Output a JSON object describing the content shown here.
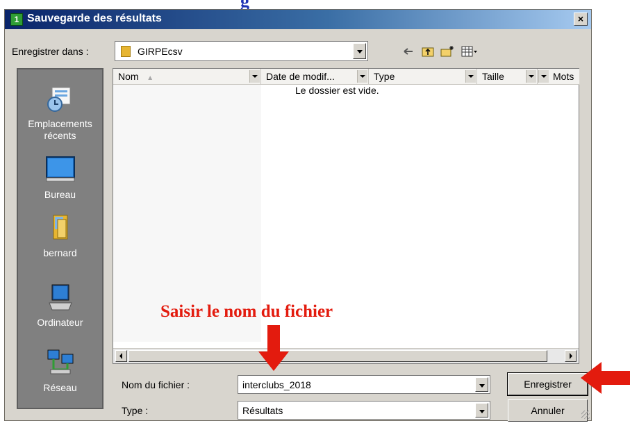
{
  "top_fragment": "g",
  "window": {
    "title": "Sauvegarde des résultats",
    "app_icon_text": "1",
    "close_label": "×"
  },
  "toolbar": {
    "lookin_label": "Enregistrer dans :",
    "lookin_value": "GIRPEcsv",
    "back_icon": "back-arrow-icon",
    "up_icon": "up-folder-icon",
    "newfolder_icon": "new-folder-icon",
    "views_icon": "views-menu-icon"
  },
  "places": [
    {
      "label": "Emplacements récents",
      "icon": "recent-places-icon"
    },
    {
      "label": "Bureau",
      "icon": "desktop-icon"
    },
    {
      "label": "bernard",
      "icon": "user-folder-icon"
    },
    {
      "label": "Ordinateur",
      "icon": "computer-icon"
    },
    {
      "label": "Réseau",
      "icon": "network-icon"
    }
  ],
  "file_list": {
    "columns": [
      "Nom",
      "Date de modif...",
      "Type",
      "Taille",
      "Mots"
    ],
    "sort_indicator": "▲",
    "empty_message": "Le dossier est vide."
  },
  "form": {
    "filename_label": "Nom du fichier :",
    "filename_value": "interclubs_2018",
    "type_label": "Type :",
    "type_value": "Résultats",
    "save_button": "Enregistrer",
    "cancel_button": "Annuler"
  },
  "annotation": {
    "text": "Saisir le nom du fichier",
    "color": "#e31b0e"
  }
}
